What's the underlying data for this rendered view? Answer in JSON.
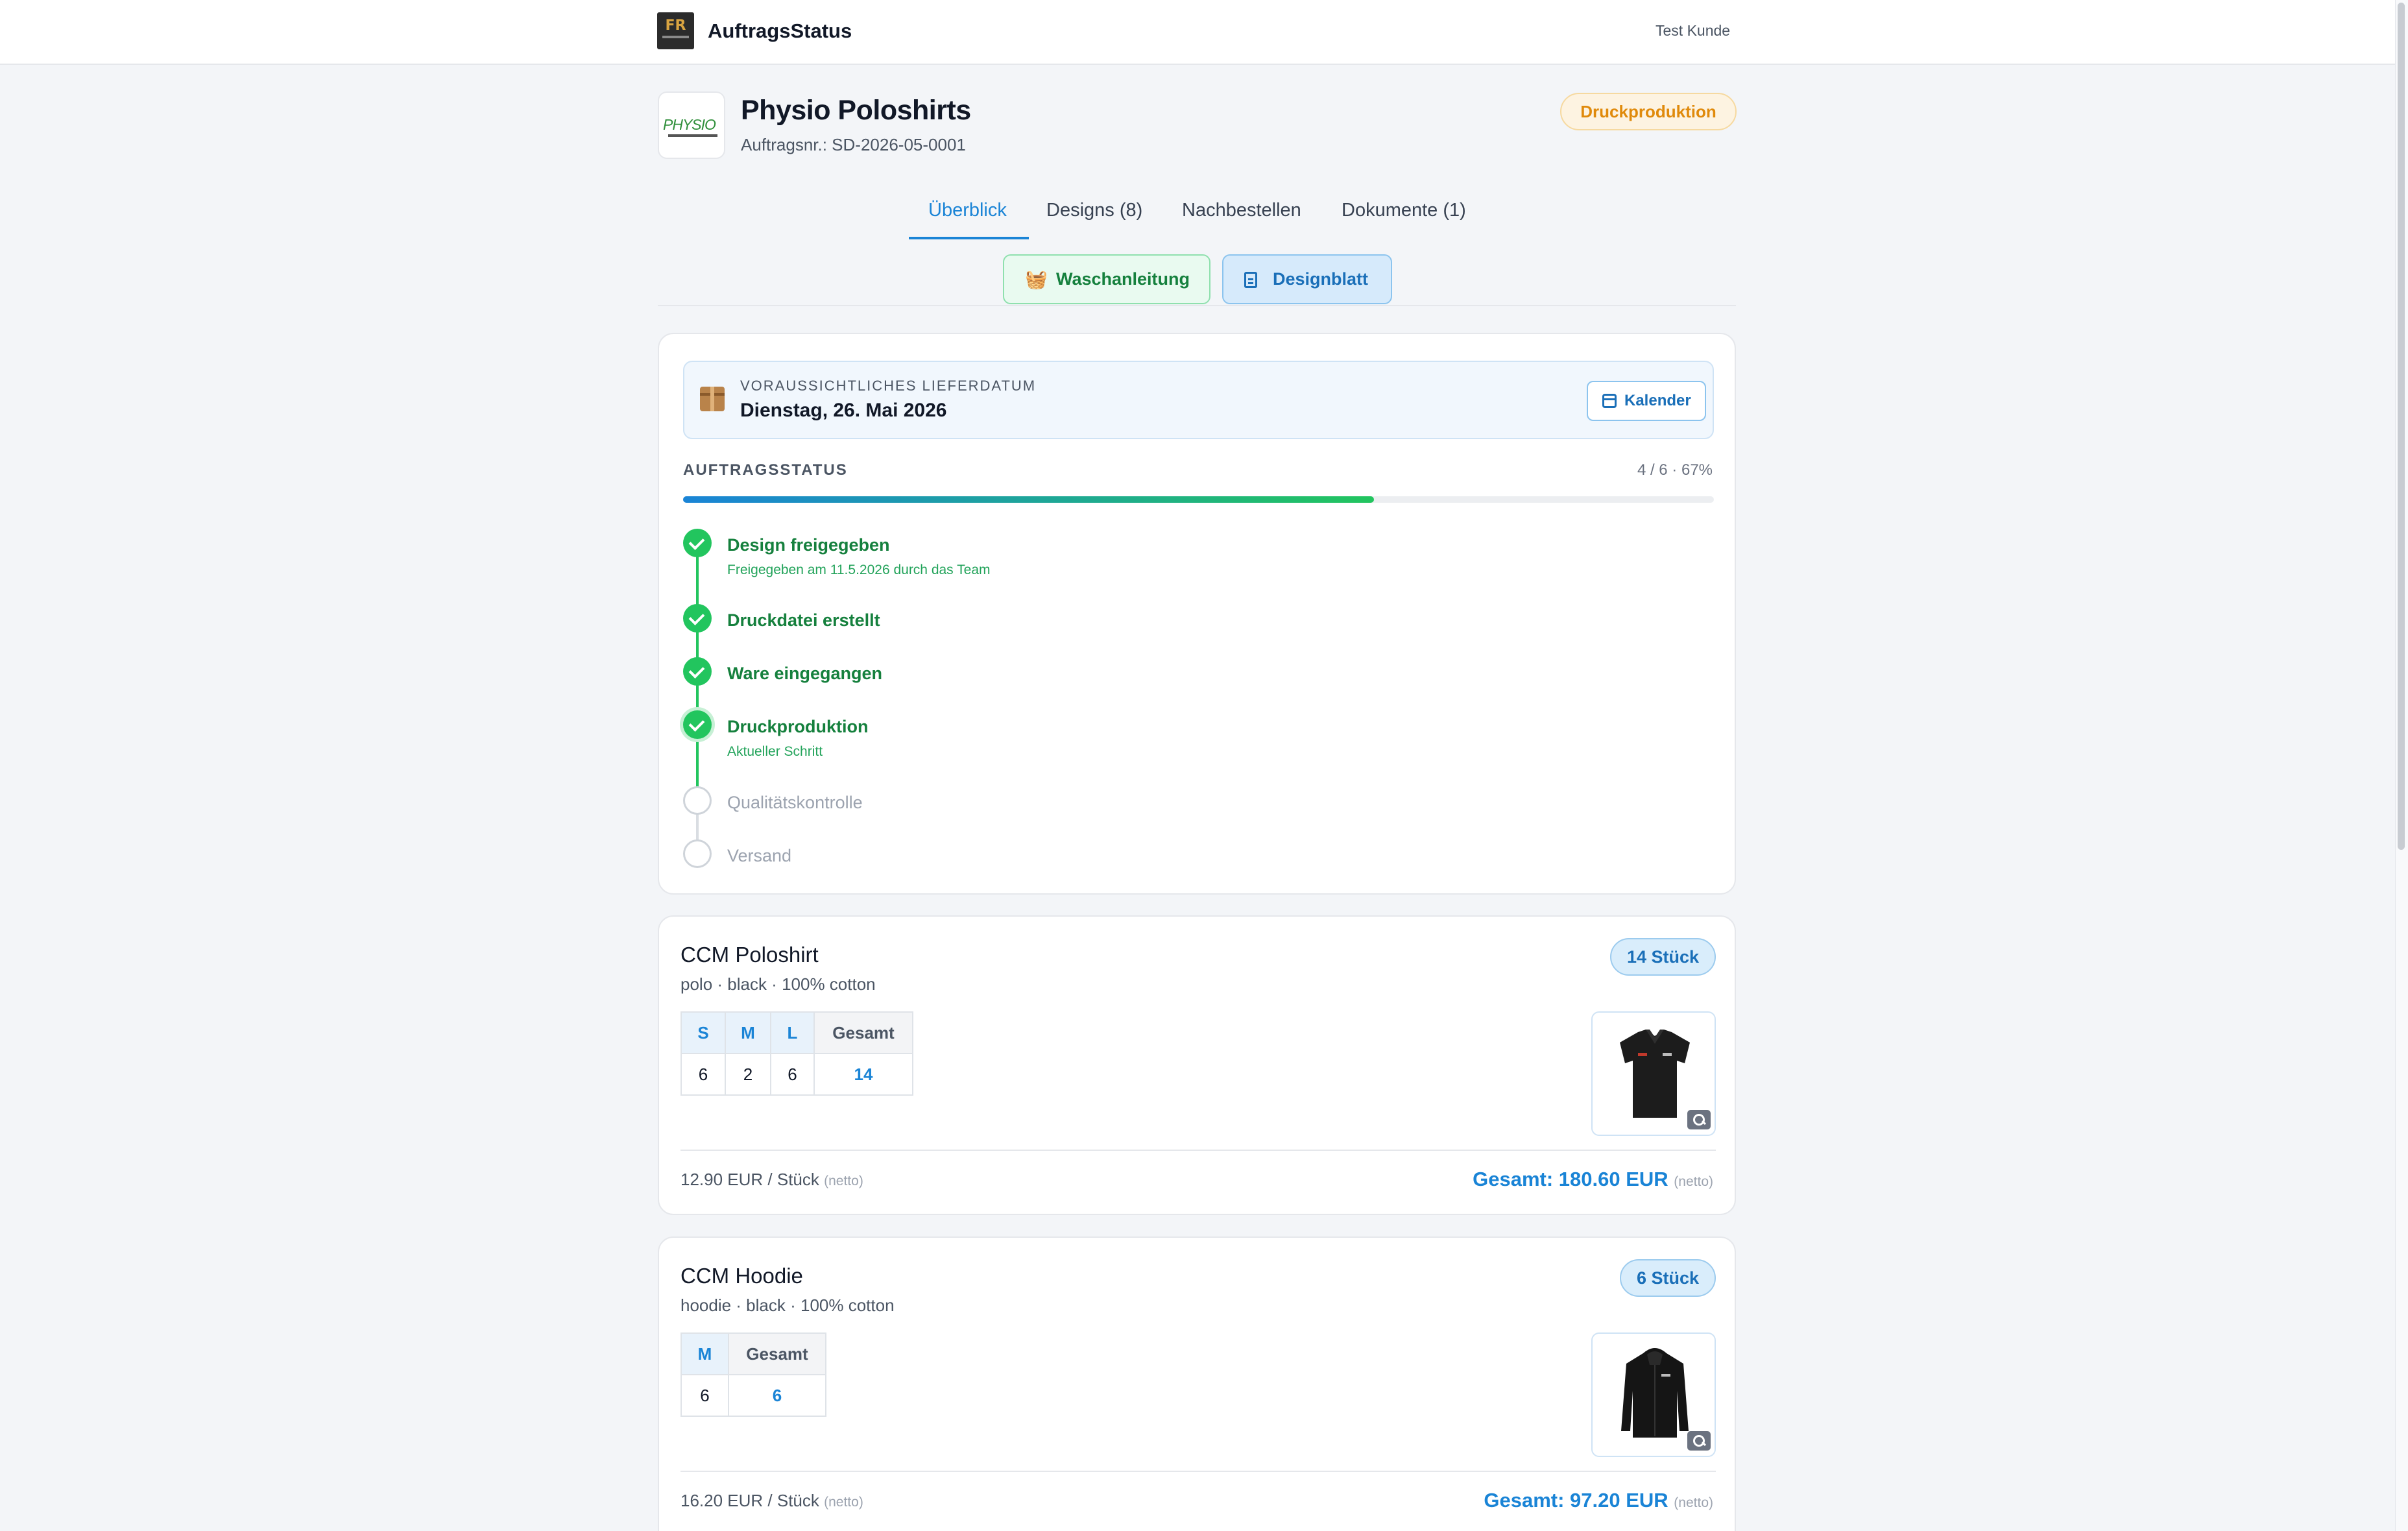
{
  "header": {
    "app_title": "AuftragsStatus",
    "logo_text": "FR",
    "user": "Test Kunde"
  },
  "order": {
    "logo_text": "PHYSIO",
    "title": "Physio Poloshirts",
    "number": "Auftragsnr.: SD-2026-05-0001",
    "status": "Druckproduktion"
  },
  "tabs": [
    {
      "label": "Überblick",
      "active": true
    },
    {
      "label": "Designs (8)",
      "active": false
    },
    {
      "label": "Nachbestellen",
      "active": false
    },
    {
      "label": "Dokumente (1)",
      "active": false
    }
  ],
  "actions": {
    "wash_label": "Waschanleitung",
    "wash_icon": "basket-icon",
    "design_label": "Designblatt",
    "design_icon": "document-icon"
  },
  "delivery": {
    "label": "VORAUSSICHTLICHES LIEFERDATUM",
    "date": "Dienstag, 26. Mai 2026",
    "calendar_label": "Kalender"
  },
  "progress": {
    "title": "AUFTRAGSSTATUS",
    "count": "4 / 6 · 67%",
    "fraction": 0.67
  },
  "steps": [
    {
      "label": "Design freigegeben",
      "note": "Freigegeben am 11.5.2026 durch das Team",
      "state": "done"
    },
    {
      "label": "Druckdatei erstellt",
      "note": "",
      "state": "done"
    },
    {
      "label": "Ware eingegangen",
      "note": "",
      "state": "done"
    },
    {
      "label": "Druckproduktion",
      "note": "Aktueller Schritt",
      "state": "current"
    },
    {
      "label": "Qualitätskontrolle",
      "note": "",
      "state": "todo"
    },
    {
      "label": "Versand",
      "note": "",
      "state": "todo"
    }
  ],
  "products": [
    {
      "name": "CCM Poloshirt",
      "meta": "polo · black · 100% cotton",
      "qty": "14 Stück",
      "sizes": [
        "S",
        "M",
        "L"
      ],
      "amounts": [
        "6",
        "2",
        "6"
      ],
      "total_header": "Gesamt",
      "total": "14",
      "unit_price": "12.90 EUR / Stück",
      "netto": "(netto)",
      "total_price": "Gesamt: 180.60 EUR"
    },
    {
      "name": "CCM Hoodie",
      "meta": "hoodie · black · 100% cotton",
      "qty": "6 Stück",
      "sizes": [
        "M"
      ],
      "amounts": [
        "6"
      ],
      "total_header": "Gesamt",
      "total": "6",
      "unit_price": "16.20 EUR / Stück",
      "netto": "(netto)",
      "total_price": "Gesamt: 97.20 EUR"
    }
  ],
  "colors": {
    "accent": "#1a84d6",
    "success": "#22c55e",
    "warning": "#e08a0b"
  }
}
